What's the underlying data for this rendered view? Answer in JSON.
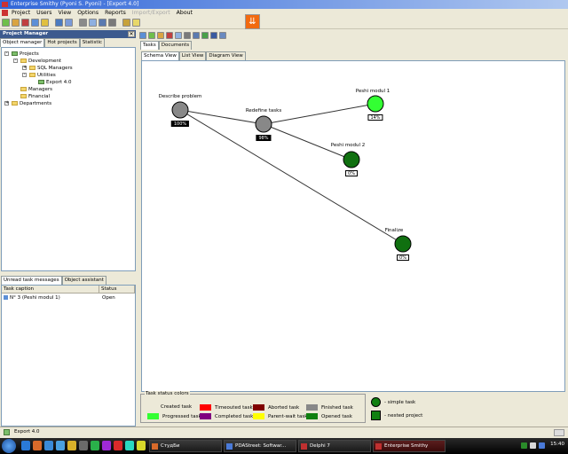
{
  "window": {
    "title": "Enterprise Smithy (Pyoni S. Pyoni) - [Export 4.0]"
  },
  "menu": {
    "items": [
      {
        "label": "Project"
      },
      {
        "label": "Users"
      },
      {
        "label": "View"
      },
      {
        "label": "Options"
      },
      {
        "label": "Reports"
      },
      {
        "label": "Import/Export"
      },
      {
        "label": "About"
      }
    ]
  },
  "big_button": {
    "glyph": "⇊"
  },
  "project_manager": {
    "title": "Project Manager",
    "close_glyph": "✕",
    "tabs": [
      "Object manager",
      "Hot projects",
      "Statistic"
    ],
    "tree": {
      "root": "Projects",
      "development": "Development",
      "sql_managers": "SQL Managers",
      "utilities": "Utilities",
      "export": "Export 4.0",
      "managers": "Managers",
      "financial": "Financial",
      "departments": "Departments"
    }
  },
  "messages": {
    "tabs": [
      "Unread task messages",
      "Object assistant"
    ],
    "columns": [
      "Task caption",
      "Status"
    ],
    "rows": [
      {
        "caption": "N° 3 (Peshi modul 1)",
        "status": "Open"
      }
    ]
  },
  "content": {
    "top_tabs": [
      "Tasks",
      "Documents"
    ],
    "view_tabs": [
      "Schema View",
      "List View",
      "Diagram View"
    ]
  },
  "schema": {
    "nodes": [
      {
        "label": "Describe problem",
        "pct": "100%",
        "color": "#888888"
      },
      {
        "label": "Redefine tasks",
        "pct": "98%",
        "color": "#888888"
      },
      {
        "label": "Peshi modul 1",
        "pct": "14%",
        "color": "#33ff33"
      },
      {
        "label": "Peshi modul 2",
        "pct": "0%",
        "color": "#107010"
      },
      {
        "label": "Finalize",
        "pct": "0%",
        "color": "#107010"
      }
    ]
  },
  "legend": {
    "title": "Task status colors",
    "items": [
      {
        "label": "Created task",
        "color": "#ffffff"
      },
      {
        "label": "Progressed task",
        "color": "#33ff33"
      },
      {
        "label": "Timeouted task",
        "color": "#ff0000"
      },
      {
        "label": "Completed task",
        "color": "#800080"
      },
      {
        "label": "Aborted task",
        "color": "#800000"
      },
      {
        "label": "Parent-wait task",
        "color": "#ffff00"
      },
      {
        "label": "Finished task",
        "color": "#888888"
      },
      {
        "label": "Opened task",
        "color": "#108010"
      }
    ],
    "shape_items": [
      {
        "label": "- simple task"
      },
      {
        "label": "- nested project"
      }
    ]
  },
  "statusbar": {
    "text": "Export 4.0"
  },
  "taskbar": {
    "buttons": [
      {
        "label": "СтудБи"
      },
      {
        "label": "PDAStreet: Softwar..."
      },
      {
        "label": "Delphi 7"
      },
      {
        "label": "Enterprise Smithy"
      }
    ],
    "clock": "15:40"
  }
}
